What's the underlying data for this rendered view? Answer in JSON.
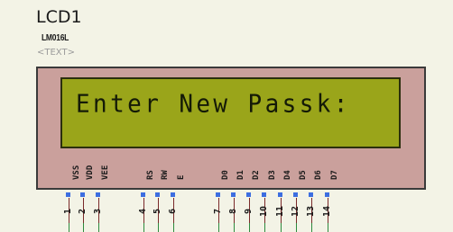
{
  "component": {
    "title": "LCD1",
    "model": "LM016L",
    "text_placeholder": "<TEXT>"
  },
  "display": {
    "line1": "Enter New Passk:"
  },
  "pins": [
    {
      "label": "VSS",
      "num": "1"
    },
    {
      "label": "VDD",
      "num": "2"
    },
    {
      "label": "VEE",
      "num": "3"
    },
    {
      "label": "RS",
      "num": "4"
    },
    {
      "label": "RW",
      "num": "5"
    },
    {
      "label": "E",
      "num": "6"
    },
    {
      "label": "D0",
      "num": "7"
    },
    {
      "label": "D1",
      "num": "8"
    },
    {
      "label": "D2",
      "num": "9"
    },
    {
      "label": "D3",
      "num": "10"
    },
    {
      "label": "D4",
      "num": "11"
    },
    {
      "label": "D5",
      "num": "12"
    },
    {
      "label": "D6",
      "num": "13"
    },
    {
      "label": "D7",
      "num": "14"
    }
  ],
  "colors": {
    "screen": "#9aa51a",
    "frame": "#caa09c",
    "pin_dot": "#3d6ee0"
  }
}
